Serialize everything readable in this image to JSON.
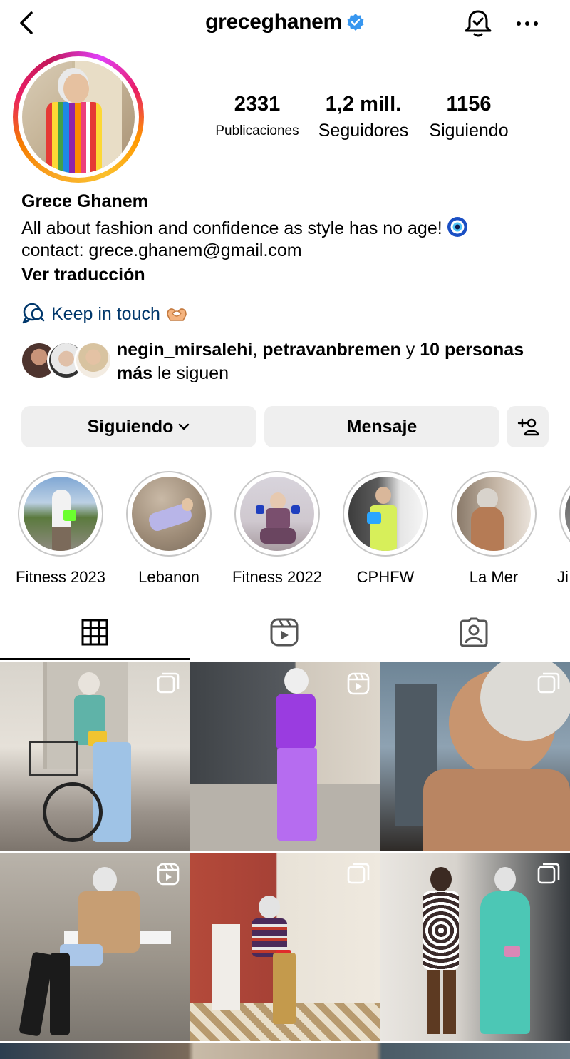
{
  "header": {
    "username": "greceghanem",
    "verified_icon": "verified-badge-icon",
    "back_icon": "chevron-left-icon",
    "notifications_icon": "bell-check-icon",
    "more_icon": "more-horizontal-icon"
  },
  "profile": {
    "stats": {
      "posts": {
        "value": "2331",
        "label": "Publicaciones"
      },
      "followers": {
        "value": "1,2 mill.",
        "label": "Seguidores"
      },
      "following": {
        "value": "1156",
        "label": "Siguiendo"
      }
    },
    "name": "Grece Ghanem",
    "bio_line1": "All about fashion and confidence as style has no age!",
    "bio_line2": "contact: grece.ghanem@gmail.com",
    "translate_label": "Ver traducción",
    "link_label": "Keep in touch",
    "link_icon": "threads-icon"
  },
  "mutuals": {
    "user1": "negin_mirsalehi",
    "separator": ", ",
    "user2": "petravanbremen",
    "connector": " y ",
    "others": "10 personas más",
    "suffix": " le siguen"
  },
  "actions": {
    "following_label": "Siguiendo",
    "message_label": "Mensaje",
    "add_user_icon": "add-person-icon"
  },
  "highlights": [
    {
      "label": "Fitness 2023"
    },
    {
      "label": "Lebanon"
    },
    {
      "label": "Fitness 2022"
    },
    {
      "label": "CPHFW"
    },
    {
      "label": "La Mer"
    },
    {
      "label": "Ji"
    }
  ],
  "tabs": [
    {
      "icon": "grid-icon",
      "active": true
    },
    {
      "icon": "reels-icon",
      "active": false
    },
    {
      "icon": "tagged-icon",
      "active": false
    }
  ],
  "colors": {
    "link": "#00376b",
    "button_bg": "#efefef",
    "verified": "#3897f0"
  }
}
